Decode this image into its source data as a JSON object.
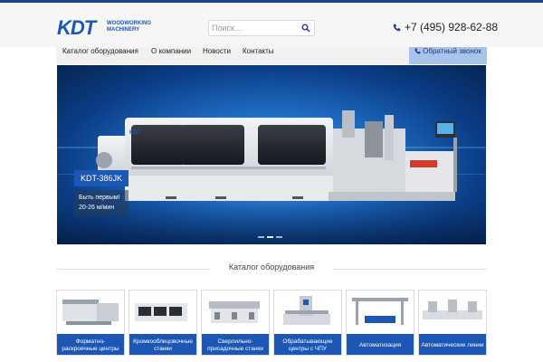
{
  "logo": {
    "mark": "KDT",
    "line1": "WOODWORKING",
    "line2": "MACHINERY"
  },
  "search": {
    "placeholder": "Поиск..."
  },
  "phone": "+7 (495) 928-62-88",
  "nav": [
    "Каталог оборудования",
    "О компании",
    "Новости",
    "Контакты"
  ],
  "callback": "Обратный звонок",
  "hero": {
    "title": "KDT-386JK",
    "subtitle_line1": "Быть первым!",
    "subtitle_line2": "20-26 м/мин",
    "slides": 3,
    "active_slide": 2,
    "machine_brand": "KDT"
  },
  "catalog": {
    "title": "Каталог оборудования",
    "items": [
      {
        "label": "Форматно-раскроечные центры"
      },
      {
        "label": "Кромкооблицовочные станки"
      },
      {
        "label": "Сверлильно-присадочные станки"
      },
      {
        "label": "Обрабатывающие центры с ЧПУ"
      },
      {
        "label": "Автоматизация"
      },
      {
        "label": "Автоматические линии"
      }
    ]
  },
  "colors": {
    "brand": "#1c57b5",
    "topbar": "#1c3f94",
    "callback_bg": "#a9c4ea",
    "header_bg": "#f6f6f7"
  }
}
